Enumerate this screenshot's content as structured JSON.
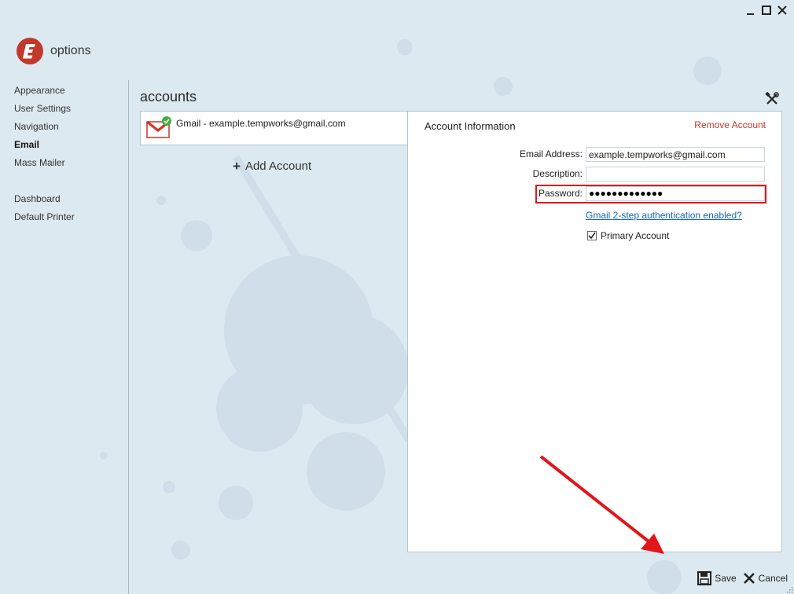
{
  "app": {
    "title": "options"
  },
  "colors": {
    "accent_red": "#c0392b",
    "link_blue": "#1565c0",
    "highlight": "#e0161b"
  },
  "window_controls": {
    "minimize_icon": "minimize-icon",
    "maximize_icon": "maximize-icon",
    "close_icon": "close-icon"
  },
  "sidebar": {
    "items": [
      {
        "label": "Appearance"
      },
      {
        "label": "User Settings"
      },
      {
        "label": "Navigation"
      },
      {
        "label": "Email",
        "active": true
      },
      {
        "label": "Mass Mailer"
      },
      {
        "label": "Dashboard"
      },
      {
        "label": "Default Printer"
      }
    ]
  },
  "main": {
    "section_title": "accounts",
    "accounts": [
      {
        "label": "Gmail - example.tempworks@gmail.com",
        "icon": "gmail-icon"
      }
    ],
    "add_account_label": "Add Account"
  },
  "account_info": {
    "title": "Account Information",
    "remove_label": "Remove Account",
    "email_label": "Email Address:",
    "email_value": "example.tempworks@gmail.com",
    "description_label": "Description:",
    "description_value": "",
    "password_label": "Password:",
    "password_mask": "●●●●●●●●●●●●●",
    "twostep_link": "Gmail 2-step authentication enabled?",
    "primary_label": "Primary Account",
    "primary_checked": true
  },
  "footer": {
    "save_label": "Save",
    "cancel_label": "Cancel"
  }
}
